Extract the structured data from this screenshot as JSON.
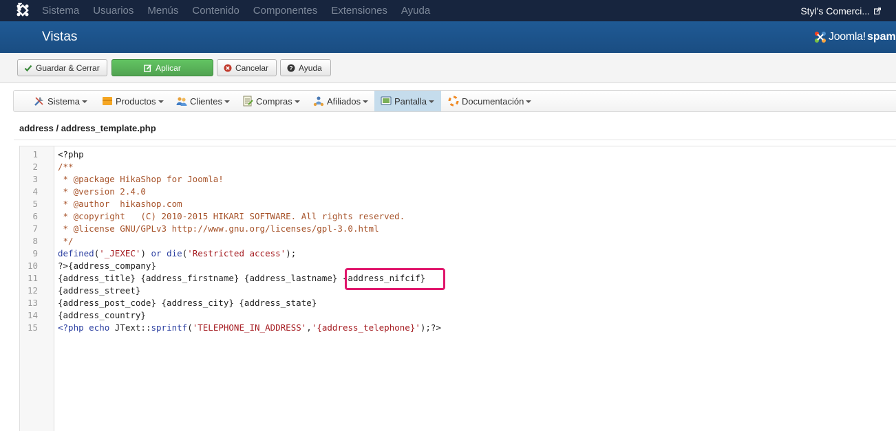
{
  "topbar": {
    "menu": [
      "Sistema",
      "Usuarios",
      "Menús",
      "Contenido",
      "Componentes",
      "Extensiones",
      "Ayuda"
    ],
    "site_link": "Styl's Comerci..."
  },
  "header": {
    "title": "Vistas",
    "brand_word": "Joomla!",
    "brand_suffix": "spam"
  },
  "toolbar": {
    "save_close": "Guardar & Cerrar",
    "apply": "Aplicar",
    "cancel": "Cancelar",
    "help": "Ayuda"
  },
  "hikashop_menu": {
    "items": [
      "Sistema",
      "Productos",
      "Clientes",
      "Compras",
      "Afiliados",
      "Pantalla",
      "Documentación"
    ],
    "active": "Pantalla"
  },
  "path": "address / address_template.php",
  "editor": {
    "line_numbers": [
      "1",
      "2",
      "3",
      "4",
      "5",
      "6",
      "7",
      "8",
      "9",
      "10",
      "11",
      "12",
      "13",
      "14",
      "15"
    ],
    "lines": [
      [
        {
          "t": "def",
          "v": "<?php"
        }
      ],
      [
        {
          "t": "com",
          "v": "/**"
        }
      ],
      [
        {
          "t": "com",
          "v": " * @package HikaShop for Joomla!"
        }
      ],
      [
        {
          "t": "com",
          "v": " * @version 2.4.0"
        }
      ],
      [
        {
          "t": "com",
          "v": " * @author  hikashop.com"
        }
      ],
      [
        {
          "t": "com",
          "v": " * @copyright   (C) 2010-2015 HIKARI SOFTWARE. All rights reserved."
        }
      ],
      [
        {
          "t": "com",
          "v": " * @license GNU/GPLv3 http://www.gnu.org/licenses/gpl-3.0.html"
        }
      ],
      [
        {
          "t": "com",
          "v": " */"
        }
      ],
      [
        {
          "t": "kw",
          "v": "defined"
        },
        {
          "t": "def",
          "v": "("
        },
        {
          "t": "str",
          "v": "'_JEXEC'"
        },
        {
          "t": "def",
          "v": ") "
        },
        {
          "t": "kw",
          "v": "or"
        },
        {
          "t": "def",
          "v": " "
        },
        {
          "t": "kw",
          "v": "die"
        },
        {
          "t": "def",
          "v": "("
        },
        {
          "t": "str",
          "v": "'Restricted access'"
        },
        {
          "t": "def",
          "v": ");"
        }
      ],
      [
        {
          "t": "def",
          "v": "?>{address_company}"
        }
      ],
      [
        {
          "t": "def",
          "v": "{address_title} {address_firstname} {address_lastname} {address_nifcif}"
        }
      ],
      [
        {
          "t": "def",
          "v": "{address_street}"
        }
      ],
      [
        {
          "t": "def",
          "v": "{address_post_code} {address_city} {address_state}"
        }
      ],
      [
        {
          "t": "def",
          "v": "{address_country}"
        }
      ],
      [
        {
          "t": "kw",
          "v": "<?php"
        },
        {
          "t": "def",
          "v": " "
        },
        {
          "t": "kw",
          "v": "echo"
        },
        {
          "t": "def",
          "v": " JText::"
        },
        {
          "t": "kw",
          "v": "sprintf"
        },
        {
          "t": "def",
          "v": "("
        },
        {
          "t": "str",
          "v": "'TELEPHONE_IN_ADDRESS'"
        },
        {
          "t": "def",
          "v": ","
        },
        {
          "t": "str",
          "v": "'{address_telephone}'"
        },
        {
          "t": "def",
          "v": ");?>"
        }
      ]
    ],
    "highlighted_token": "{address_nifcif}"
  },
  "colors": {
    "topbar_bg": "#17253e",
    "header_bg": "#1a4d82",
    "apply_green": "#51a351",
    "highlight_border": "#e0176c",
    "comment": "#a7532a",
    "keyword": "#2a3ea0",
    "string": "#a51b20"
  }
}
